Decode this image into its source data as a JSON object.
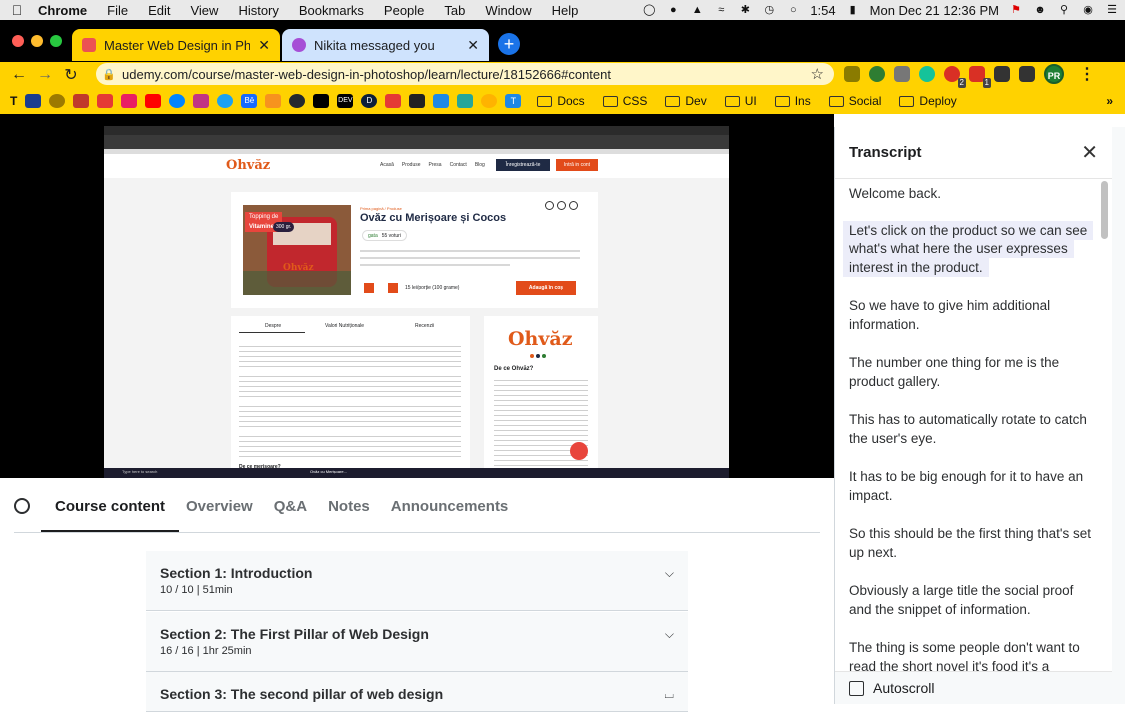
{
  "menubar": {
    "app_name": "Chrome",
    "items": [
      "File",
      "Edit",
      "View",
      "History",
      "Bookmarks",
      "People",
      "Tab",
      "Window",
      "Help"
    ],
    "battery": "1:54",
    "datetime": "Mon Dec 21 12:36 PM"
  },
  "tabs": [
    {
      "title": "Master Web Design in Phot",
      "active": true,
      "favicon_color": "#ec5252"
    },
    {
      "title": "Nikita messaged you",
      "active": false,
      "favicon_color": "#a64fd6"
    }
  ],
  "toolbar": {
    "url": "udemy.com/course/master-web-design-in-photoshop/learn/lecture/18152666#content",
    "profile_initials": "PR"
  },
  "extensions": [
    {
      "icon": "bug-icon",
      "color": "#8a7b00",
      "badge": ""
    },
    {
      "icon": "compass-icon",
      "color": "#2e7d32",
      "badge": ""
    },
    {
      "icon": "eyedropper-icon",
      "color": "#666",
      "badge": ""
    },
    {
      "icon": "grammarly-icon",
      "color": "#15c39a",
      "badge": ""
    },
    {
      "icon": "record-icon",
      "color": "#d93025",
      "badge": "2"
    },
    {
      "icon": "grid-icon",
      "color": "#d93025",
      "badge": "1"
    },
    {
      "icon": "puzzle-icon",
      "color": "#333",
      "badge": ""
    },
    {
      "icon": "playlist-icon",
      "color": "#333",
      "badge": ""
    }
  ],
  "bookmarks": {
    "icons": [
      {
        "label": "T",
        "color": "#ffd200"
      },
      {
        "label": "",
        "color": "#1a3d8f"
      },
      {
        "label": "",
        "color": "#9c7a00"
      },
      {
        "label": "",
        "color": "#c0392b"
      },
      {
        "label": "",
        "color": "#e53935"
      },
      {
        "label": "",
        "color": "#e91e63"
      },
      {
        "label": "",
        "color": "#ff0000"
      },
      {
        "label": "",
        "color": "#0084ff"
      },
      {
        "label": "",
        "color": "#c13584"
      },
      {
        "label": "",
        "color": "#1da1f2"
      },
      {
        "label": "Bē",
        "color": "#1769ff"
      },
      {
        "label": "",
        "color": "#f7931e"
      },
      {
        "label": "",
        "color": "#24292e"
      },
      {
        "label": "",
        "color": "#000"
      },
      {
        "label": "DEV",
        "color": "#000"
      },
      {
        "label": "D",
        "color": "#0b1f3a"
      },
      {
        "label": "",
        "color": "#e53935"
      },
      {
        "label": "",
        "color": "#222"
      },
      {
        "label": "",
        "color": "#1e88e5"
      },
      {
        "label": "",
        "color": "#26a69a"
      },
      {
        "label": "",
        "color": "#ffb300"
      },
      {
        "label": "T",
        "color": "#1e88e5"
      }
    ],
    "folders": [
      "Docs",
      "CSS",
      "Dev",
      "UI",
      "Ins",
      "Social",
      "Deploy"
    ]
  },
  "video": {
    "site_logo": "Ohvăz",
    "nav": [
      "Acasă",
      "Produse",
      "Presa",
      "Contact",
      "Blog"
    ],
    "nav_cta": "Înregistrează-te",
    "nav_login": "Intră in cont",
    "product_title": "Ovăz cu Merișoare și Cocos",
    "breadcrumb": "Prima pagină / Produse",
    "rating_label": "gata",
    "reviews": "55 voturi",
    "price": "15 lei/porție (100 grame)",
    "add_button": "Adaugă în coș",
    "badge_topping": "Topping de",
    "badge_vitamine": "Vitamine",
    "badge_weight": "300 gr.",
    "tabs": [
      "Despre",
      "Valori Nutriționale",
      "Recenzii"
    ],
    "side_logo": "Ohvăz",
    "side_heading": "De ce Ohvăz?",
    "footer_question": "De ce merișoare?",
    "taskbar_search": "Type here to search",
    "taskbar_app": "Ovăz cu Merișoare..."
  },
  "course_tabs": {
    "active": "Course content",
    "items": [
      "Course content",
      "Overview",
      "Q&A",
      "Notes",
      "Announcements"
    ]
  },
  "sections": [
    {
      "title": "Section 1: Introduction",
      "meta": "10 / 10 | 51min",
      "expanded": false
    },
    {
      "title": "Section 2: The First Pillar of Web Design",
      "meta": "16 / 16 | 1hr 25min",
      "expanded": false
    },
    {
      "title": "Section 3: The second pillar of web design",
      "meta": "",
      "expanded": true
    }
  ],
  "transcript": {
    "title": "Transcript",
    "active_index": 1,
    "cues": [
      "Welcome back.",
      "Let's click on the product so we can see what's what here the user expresses interest in the product.",
      "So we have to give him additional information.",
      "The number one thing for me is the product gallery.",
      "This has to automatically rotate to catch the user's eye.",
      "It has to be big enough for it to have an impact.",
      "So this should be the first thing that's set up next.",
      "Obviously a large title the social proof and the snippet of information.",
      "The thing is some people don't want to read the short novel it's food it's a dessert."
    ],
    "autoscroll_label": "Autoscroll",
    "autoscroll_checked": false
  }
}
